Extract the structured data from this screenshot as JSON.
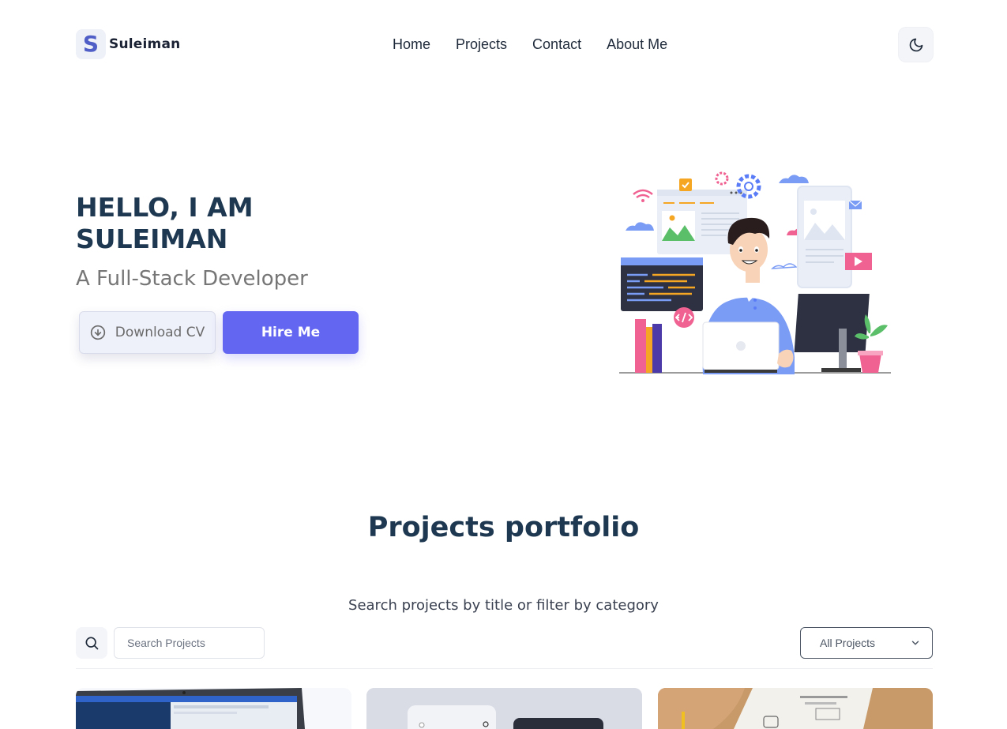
{
  "header": {
    "logo_letter": "S",
    "brand_name": "Suleiman",
    "nav": [
      {
        "label": "Home"
      },
      {
        "label": "Projects"
      },
      {
        "label": "Contact"
      },
      {
        "label": "About Me"
      }
    ],
    "theme_icon": "moon-icon"
  },
  "hero": {
    "title": "HELLO, I AM SULEIMAN",
    "subtitle": "A Full-Stack Developer",
    "download_label": "Download CV",
    "download_icon": "download-circle-icon",
    "hire_label": "Hire Me"
  },
  "projects": {
    "title": "Projects portfolio",
    "subtitle": "Search projects by title or filter by category",
    "search_placeholder": "Search Projects",
    "filter_selected": "All Projects"
  },
  "colors": {
    "accent": "#6366f1",
    "heading": "#1e3851",
    "brand_mark": "#4f5fc7"
  }
}
